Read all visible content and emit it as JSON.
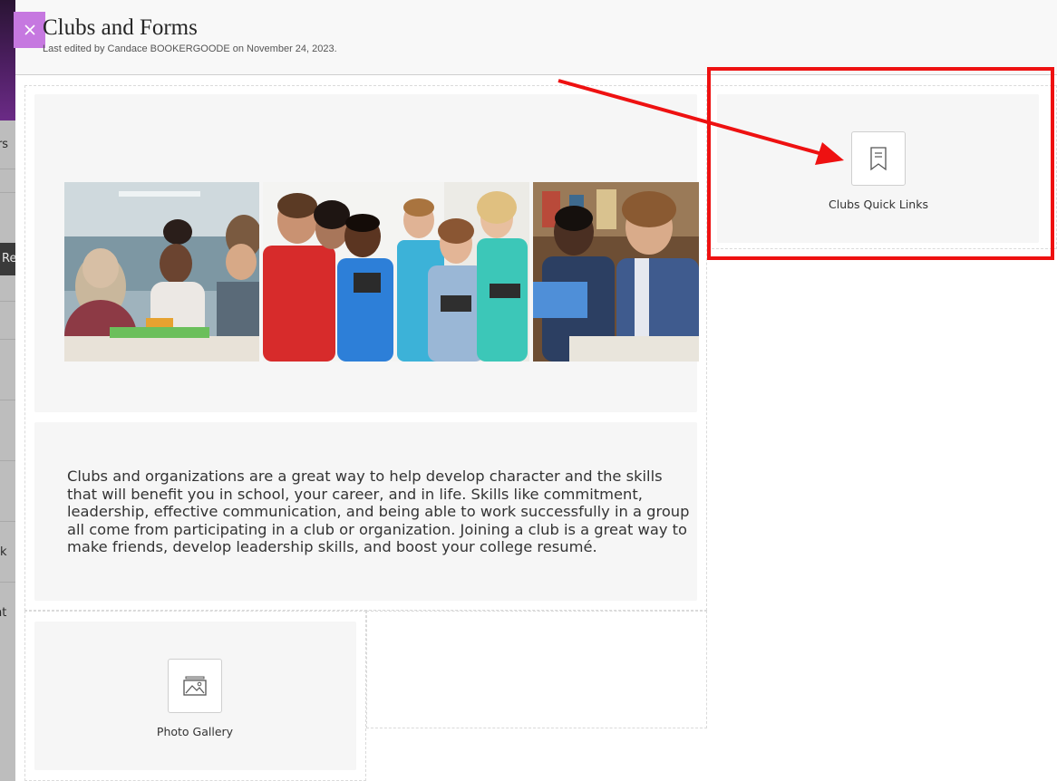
{
  "background_fragments": [
    "ors",
    "Re",
    "k",
    "ent"
  ],
  "header": {
    "title": "Clubs and Forms",
    "last_edited": "Last edited by Candace BOOKERGOODE on November 24, 2023."
  },
  "content": {
    "banner_alt": "Students collaborating in a classroom, a group of smiling students holding robots, and two students studying",
    "body_text": "Clubs and organizations are a great way to help develop character and the skills that will benefit you in school, your career, and in life. Skills like commitment, leadership, effective communication, and being able to work successfully in a group all come from participating in a club or organization. Joining a club is a great way to make friends, develop leadership skills, and boost your college resumé.",
    "quick_links_label": "Clubs Quick Links",
    "photo_gallery_label": "Photo Gallery"
  },
  "colors": {
    "close_button": "#c678e0",
    "annotation": "#ee1111",
    "tile_bg": "#f6f6f6"
  },
  "icons": {
    "close": "close-icon",
    "quick_links": "bookmark-icon",
    "gallery": "image-gallery-icon"
  }
}
